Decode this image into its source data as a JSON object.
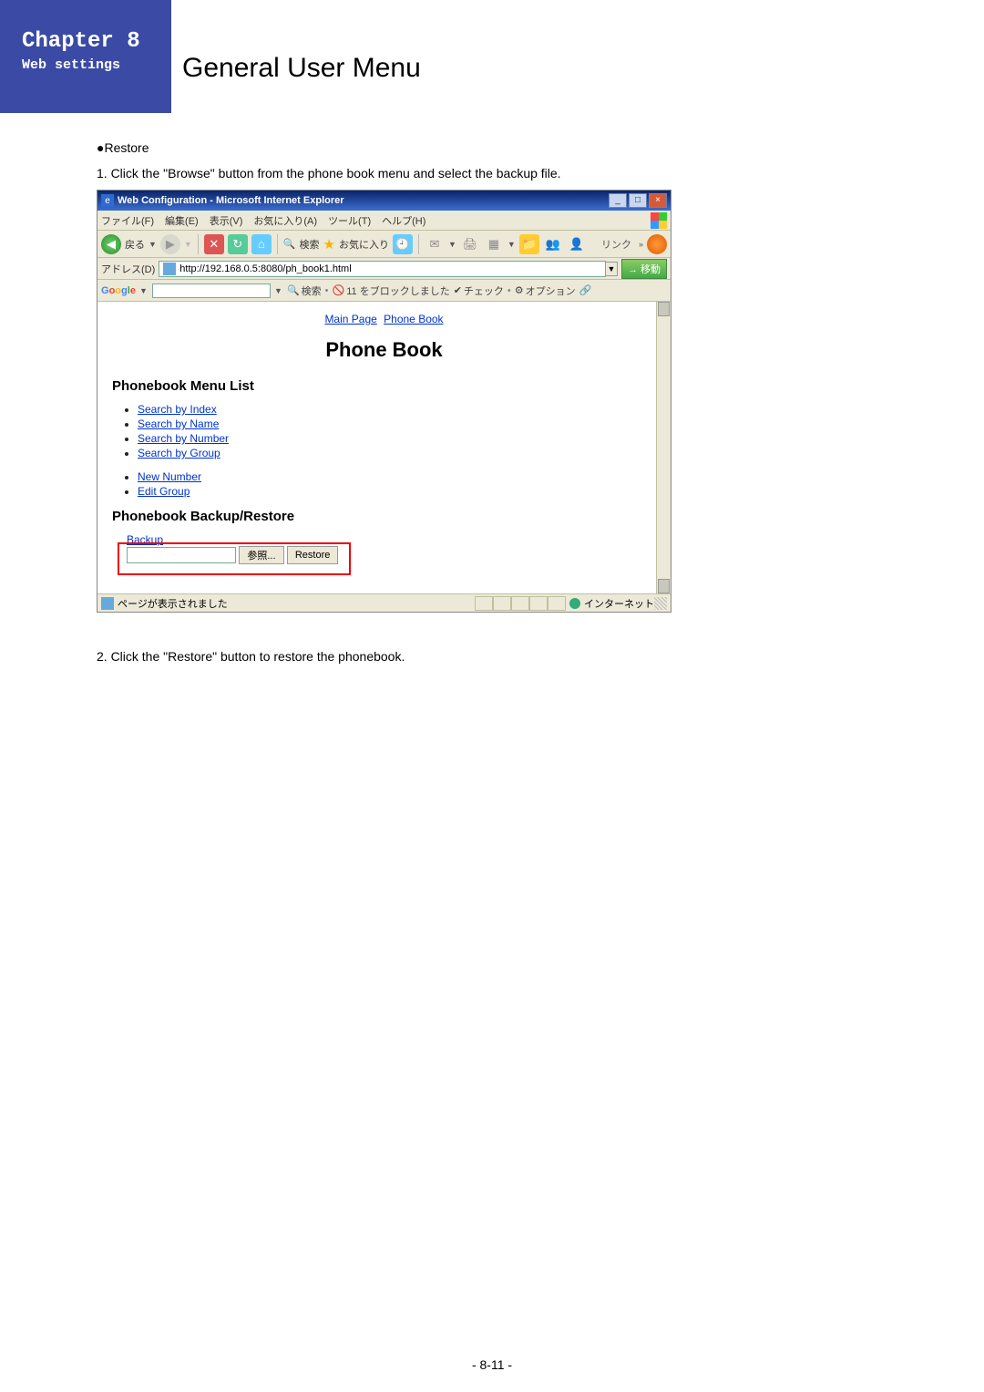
{
  "header": {
    "chapter": "Chapter 8",
    "subtitle": "Web settings",
    "title": "General User Menu"
  },
  "section": {
    "restore_bullet": "●Restore",
    "step1": "1. Click the \"Browse\" button from the phone book menu and select the backup file.",
    "step2": "2. Click the \"Restore\" button to restore the phonebook."
  },
  "ie": {
    "window_title": "Web Configuration - Microsoft Internet Explorer",
    "menus": {
      "file": "ファイル(F)",
      "edit": "編集(E)",
      "view": "表示(V)",
      "fav": "お気に入り(A)",
      "tool": "ツール(T)",
      "help": "ヘルプ(H)"
    },
    "toolbar": {
      "back": "戻る",
      "search": "検索",
      "favorites": "お気に入り",
      "links": "リンク"
    },
    "address": {
      "label": "アドレス(D)",
      "url": "http://192.168.0.5:8080/ph_book1.html",
      "go": "移動"
    },
    "google": {
      "search": "検索",
      "blocked": "11 をブロックしました",
      "check": "チェック",
      "option": "オプション"
    },
    "status": {
      "text": "ページが表示されました",
      "zone": "インターネット"
    }
  },
  "phonebook": {
    "crumb_main": "Main Page",
    "crumb_pb": "Phone Book",
    "title": "Phone Book",
    "menu_list_heading": "Phonebook Menu List",
    "links": {
      "search_index": "Search by Index",
      "search_name": "Search by Name",
      "search_number": "Search by Number",
      "search_group": "Search by Group",
      "new_number": "New Number",
      "edit_group": "Edit Group"
    },
    "backup_heading": "Phonebook Backup/Restore",
    "backup_link": "Backup",
    "browse_btn": "参照...",
    "restore_btn": "Restore"
  },
  "footer": {
    "page_number": "- 8-11 -"
  }
}
